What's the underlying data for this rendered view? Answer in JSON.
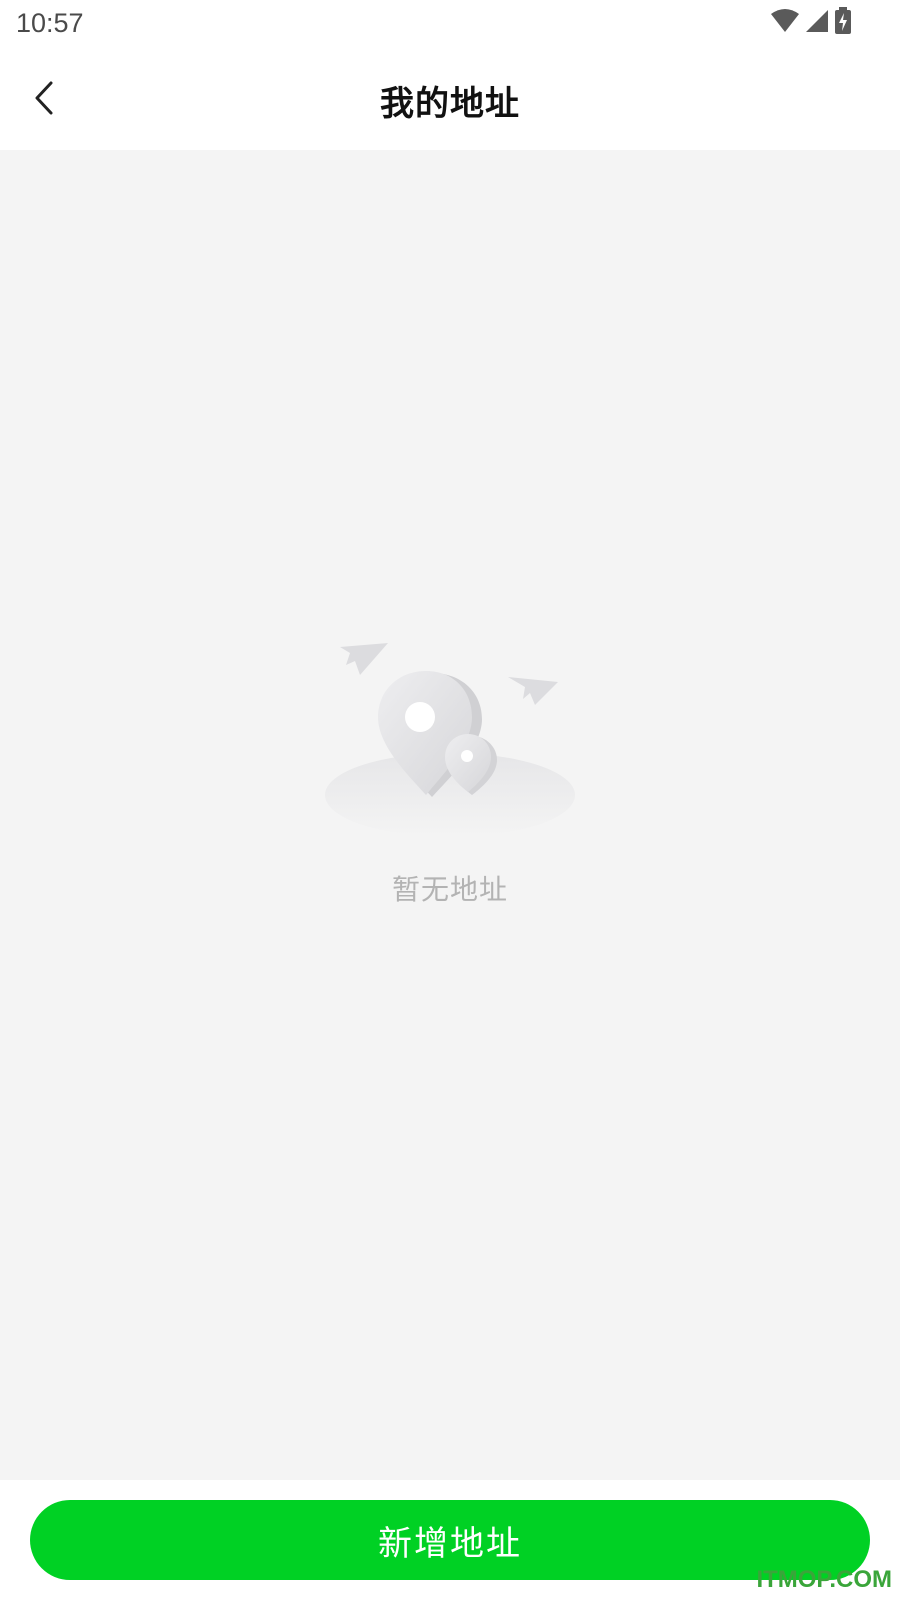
{
  "status_bar": {
    "time": "10:57",
    "icons": [
      "wifi-icon",
      "signal-icon",
      "battery-charging-icon"
    ]
  },
  "header": {
    "title": "我的地址",
    "back_icon": "chevron-left-icon"
  },
  "empty_state": {
    "message": "暂无地址",
    "illustration": "location-pins-paper-planes-illustration"
  },
  "bottom": {
    "add_button_label": "新增地址"
  },
  "watermark": "ITMOP.COM",
  "colors": {
    "accent": "#00d124",
    "background": "#f4f4f4",
    "muted_text": "#b3b3b3",
    "watermark": "#3aa53a"
  }
}
